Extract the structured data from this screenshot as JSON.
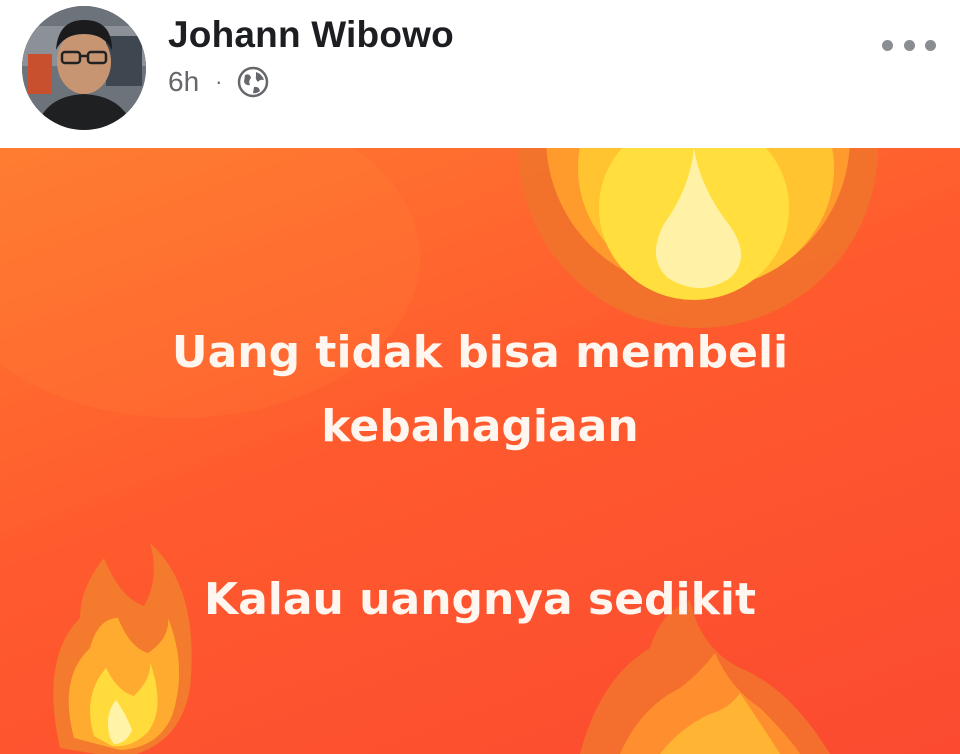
{
  "post": {
    "author_name": "Johann Wibowo",
    "timestamp": "6h",
    "separator": "·",
    "privacy_icon": "globe-icon",
    "menu_icon": "more-horizontal-icon"
  },
  "status_card": {
    "background_colors": [
      "#ff7a30",
      "#fb4a30"
    ],
    "decoration_icon": "fire-icon",
    "text_color": "#fff6ef",
    "lines": [
      "Uang tidak bisa membeli",
      "kebahagiaan",
      "Kalau uangnya sedikit"
    ]
  }
}
